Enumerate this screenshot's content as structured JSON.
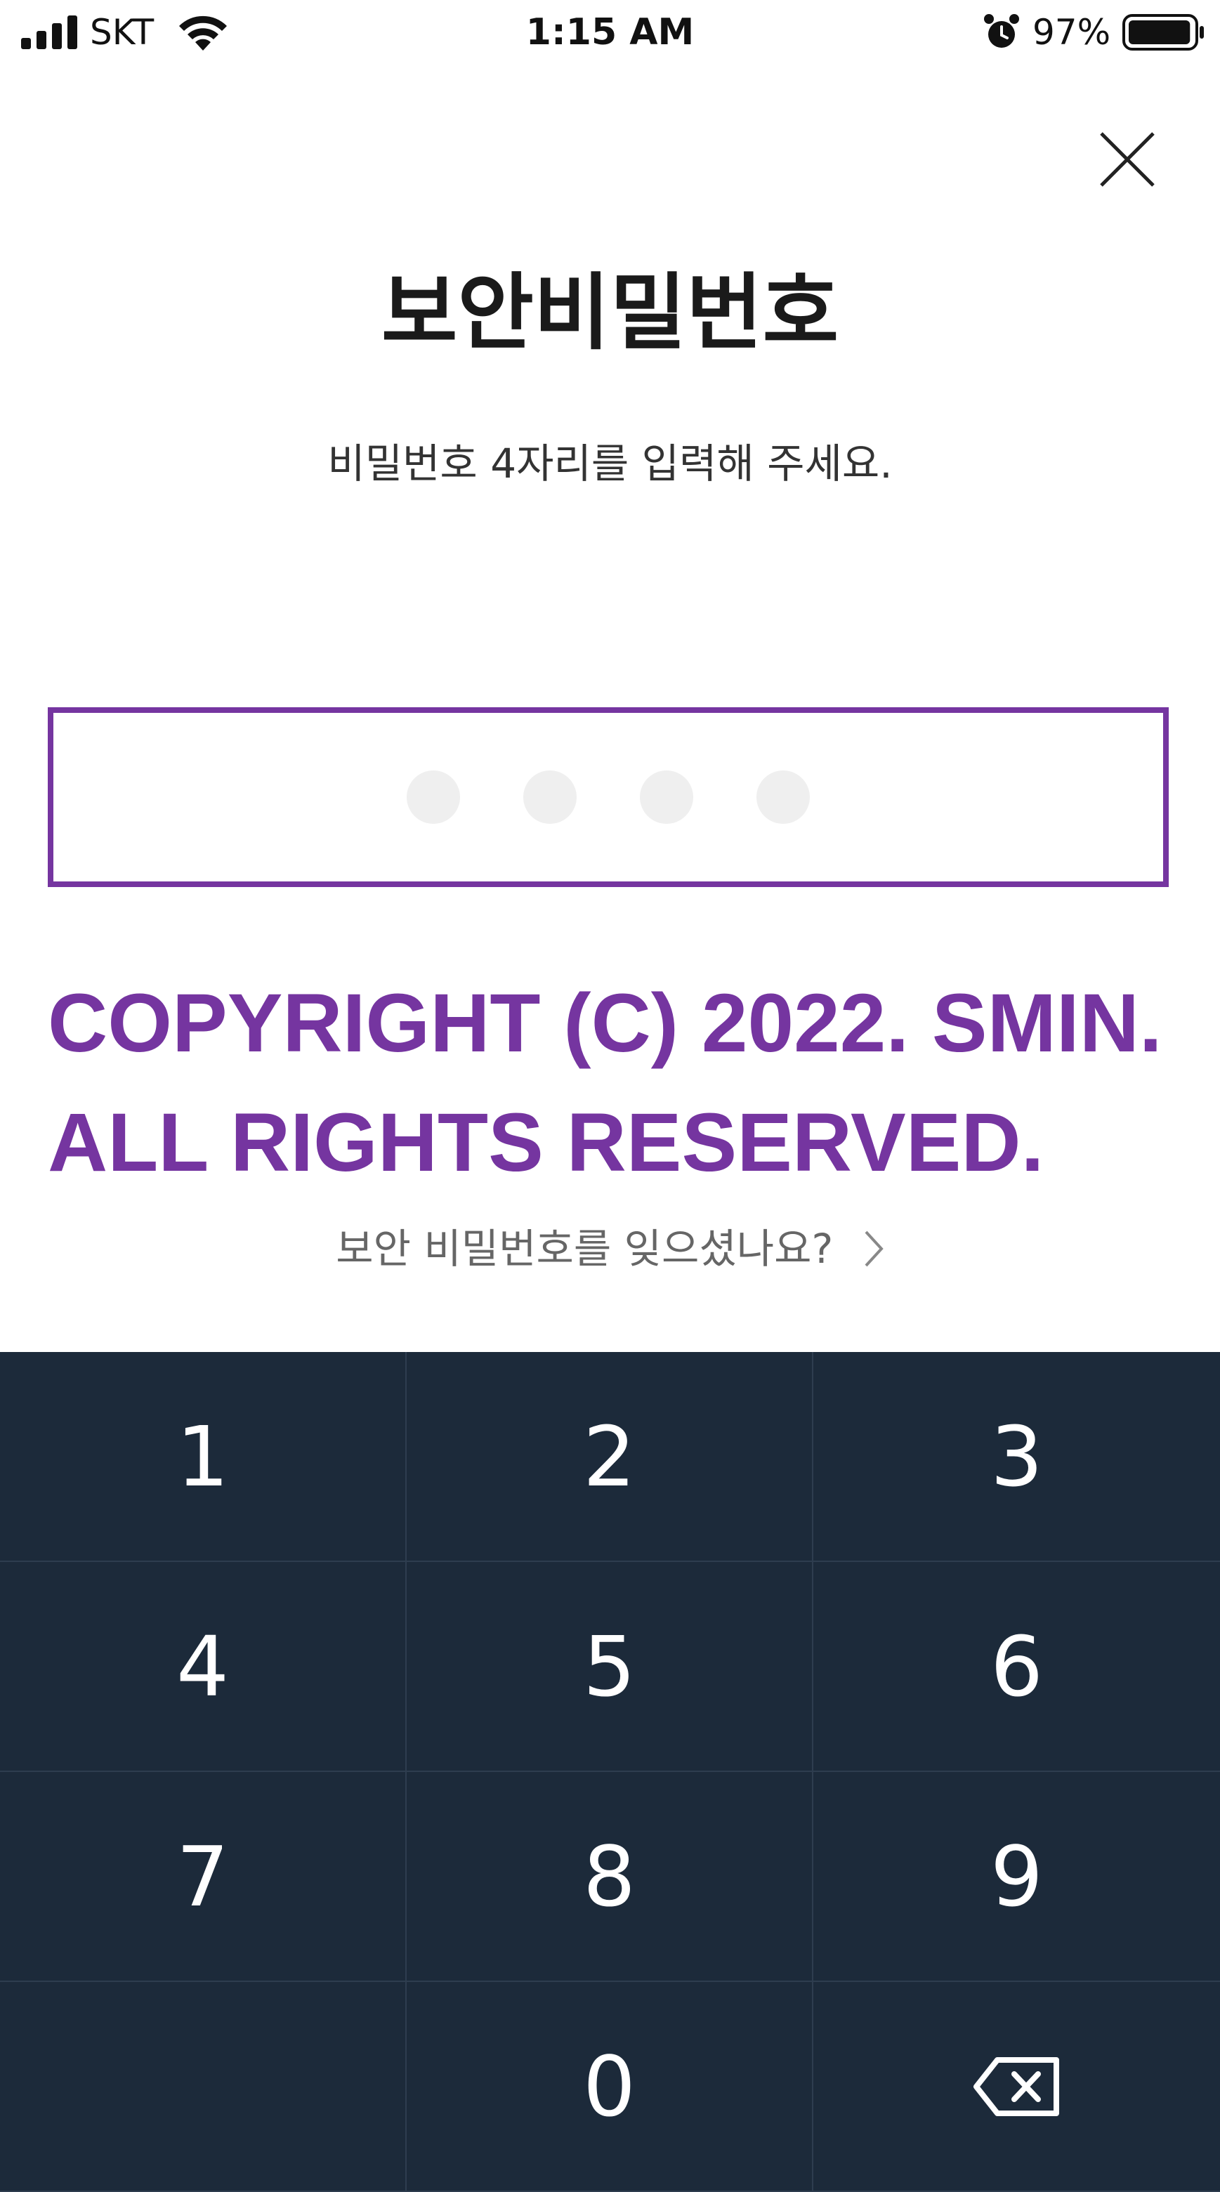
{
  "status_bar": {
    "carrier": "SKT",
    "time": "1:15 AM",
    "battery_percent": "97%",
    "battery_level": 0.97,
    "icons": [
      "signal-icon",
      "wifi-icon",
      "alarm-icon",
      "battery-icon"
    ]
  },
  "close_button": {
    "icon": "close-icon"
  },
  "header": {
    "title": "보안비밀번호",
    "subtitle": "비밀번호 4자리를 입력해 주세요."
  },
  "pin": {
    "length": 4,
    "entered": 0
  },
  "watermark": {
    "line1": "COPYRIGHT (C) 2022. SMIN.",
    "line2": "ALL RIGHTS RESERVED."
  },
  "forgot": {
    "label": "보안 비밀번호를 잊으셨나요?",
    "icon": "chevron-right-icon"
  },
  "keypad": {
    "keys": [
      "1",
      "2",
      "3",
      "4",
      "5",
      "6",
      "7",
      "8",
      "9",
      "",
      "0"
    ],
    "backspace_icon": "backspace-icon"
  },
  "colors": {
    "accent": "#7535a0",
    "keypad_bg": "#1c2a3a",
    "keypad_divider": "#2e3d4f",
    "dot": "#efefef"
  }
}
